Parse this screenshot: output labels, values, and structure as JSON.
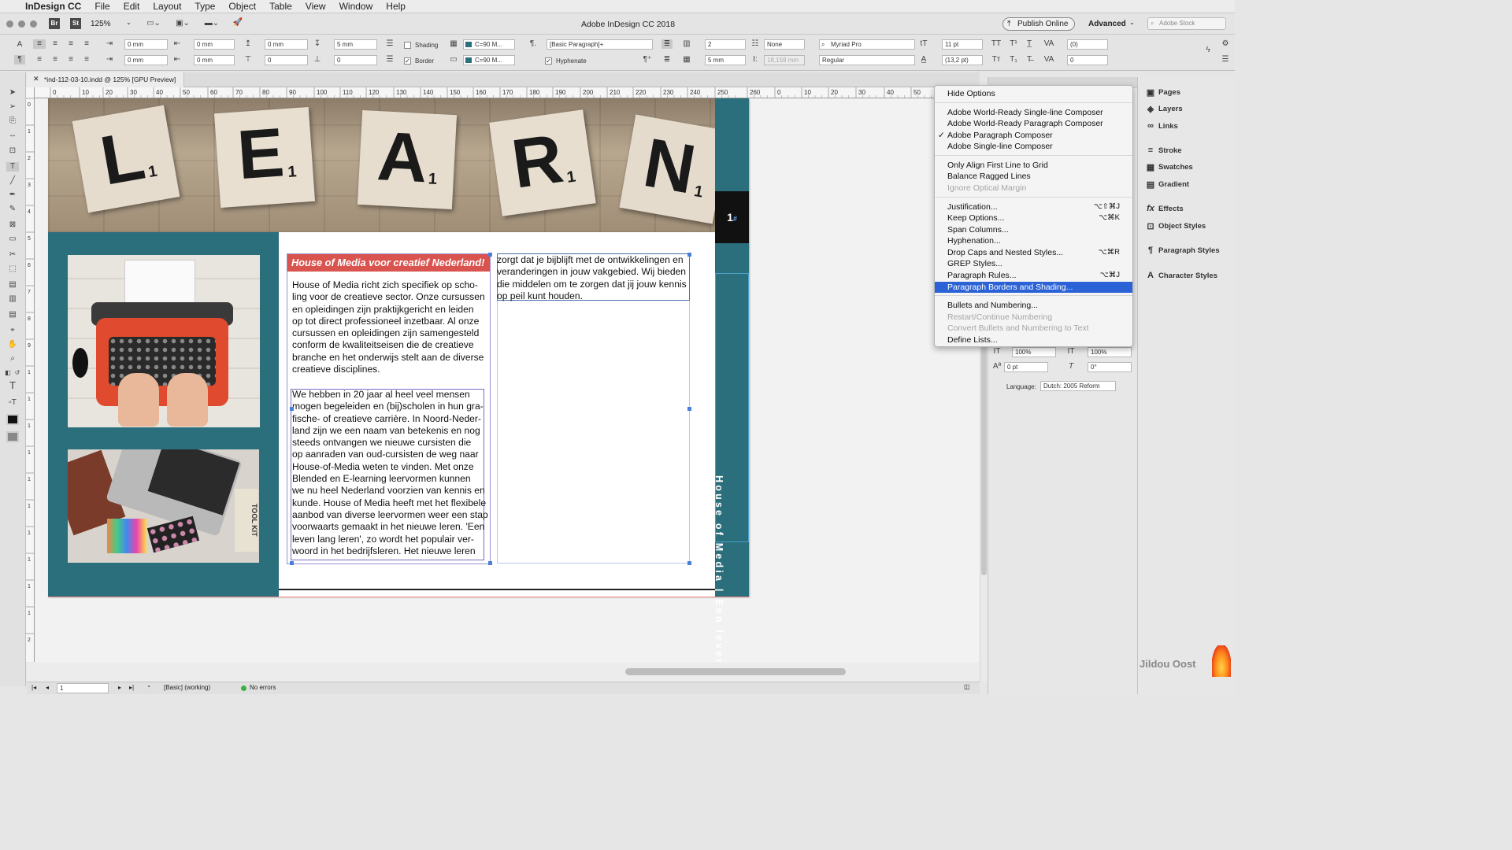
{
  "menubar": {
    "apple": "",
    "app": "InDesign CC",
    "items": [
      "File",
      "Edit",
      "Layout",
      "Type",
      "Object",
      "Table",
      "View",
      "Window",
      "Help"
    ]
  },
  "titlebar": {
    "bridge": "Br",
    "stock": "St",
    "zoom": "125%",
    "title": "Adobe InDesign CC 2018",
    "publish": "Publish Online",
    "workspace": "Advanced",
    "search_placeholder": "Adobe Stock"
  },
  "control": {
    "left_indent": "0 mm",
    "right_indent": "0 mm",
    "first_line": "0 mm",
    "last_line": "0 mm",
    "space_before": "0 mm",
    "space_after": "5 mm",
    "drop_lines": "0",
    "drop_chars": "0",
    "shading": "Shading",
    "border": "Border",
    "swatch1": "C=90 M...",
    "swatch2": "C=90 M...",
    "paragraph_style": "[Basic Paragraph]+",
    "hyphenate": "Hyphenate",
    "columns": "2",
    "gutter": "5 mm",
    "bullets": "None",
    "baseline": "18,159 mm",
    "font": "Myriad Pro",
    "font_style": "Regular",
    "size": "11 pt",
    "leading": "(13,2 pt)",
    "tracking": "(0)",
    "kerning": "0"
  },
  "document": {
    "tab_title": "*ind-112-03-10.indd @ 125% [GPU Preview]",
    "ruler_ticks": [
      "0",
      "10",
      "20",
      "30",
      "40",
      "50",
      "60",
      "70",
      "80",
      "90",
      "100",
      "110",
      "120",
      "130",
      "140",
      "150",
      "160",
      "170",
      "180",
      "190",
      "200",
      "210",
      "220",
      "230",
      "240",
      "250",
      "260",
      "0",
      "10",
      "20",
      "30",
      "40",
      "50",
      "60",
      "70"
    ],
    "vruler_ticks": [
      "0",
      "1",
      "2",
      "3",
      "4",
      "5",
      "6",
      "7",
      "8",
      "9",
      "1",
      "1",
      "1",
      "1",
      "1",
      "1",
      "1",
      "1",
      "1",
      "1",
      "2"
    ],
    "header_letters": [
      {
        "letter": "L",
        "sub": "1"
      },
      {
        "letter": "E",
        "sub": "1"
      },
      {
        "letter": "A",
        "sub": "1"
      },
      {
        "letter": "R",
        "sub": "1"
      },
      {
        "letter": "N",
        "sub": "1"
      }
    ],
    "page_number": "1",
    "page_number_marker": "#",
    "vertical_text": "House of Media | Een leven lang leren",
    "heading": "House of Media voor creatief Nederland!",
    "para1": [
      "House of Media richt zich specifiek op scho-",
      "ling voor de creatieve sector. Onze cursussen",
      "en opleidingen zijn praktijkgericht en leiden",
      "op tot direct professioneel inzetbaar. Al onze",
      "cursussen en opleidingen zijn samengesteld",
      "conform de kwaliteitseisen die de creatieve",
      "branche en het onderwijs stelt aan de diverse",
      "creatieve disciplines."
    ],
    "para2": [
      "We hebben in 20 jaar al heel veel mensen",
      "mogen begeleiden en (bij)scholen in hun gra-",
      "fische- of creatieve carrière. In Noord-Neder-",
      "land zijn we een naam van betekenis en nog",
      "steeds ontvangen we nieuwe cursisten die",
      "op aanraden van oud-cursisten de weg naar",
      "House-of-Media weten te vinden. Met onze",
      "Blended en E-learning leervormen kunnen",
      "we nu heel Nederland voorzien van kennis en",
      "kunde. House of Media heeft met het flexibele",
      "aanbod van diverse leervormen weer een stap",
      "voorwaarts gemaakt in het nieuwe leren. 'Een",
      "leven lang leren', zo wordt het populair ver-",
      "woord in het bedrijfsleren. Het nieuwe leren"
    ],
    "para3": [
      "zorgt dat je bijblijft met de ontwikkelingen en",
      "veranderingen in jouw vakgebied. Wij bieden",
      "die middelen om te zorgen dat jij jouw kennis",
      "op peil kunt houden."
    ],
    "toolkit_label": "TOOL KIT"
  },
  "dropdown": {
    "items": [
      {
        "label": "Hide Options",
        "shortcut": "",
        "disabled": false
      },
      {
        "label": "Adobe World-Ready Single-line Composer",
        "shortcut": "",
        "disabled": false
      },
      {
        "label": "Adobe World-Ready Paragraph Composer",
        "shortcut": "",
        "disabled": false
      },
      {
        "label": "Adobe Paragraph Composer",
        "shortcut": "",
        "disabled": false,
        "checked": true
      },
      {
        "label": "Adobe Single-line Composer",
        "shortcut": "",
        "disabled": false
      },
      {
        "label": "Only Align First Line to Grid",
        "shortcut": "",
        "disabled": false
      },
      {
        "label": "Balance Ragged Lines",
        "shortcut": "",
        "disabled": false
      },
      {
        "label": "Ignore Optical Margin",
        "shortcut": "",
        "disabled": true
      },
      {
        "label": "Justification...",
        "shortcut": "⌥⇧⌘J",
        "disabled": false
      },
      {
        "label": "Keep Options...",
        "shortcut": "⌥⌘K",
        "disabled": false
      },
      {
        "label": "Span Columns...",
        "shortcut": "",
        "disabled": false
      },
      {
        "label": "Hyphenation...",
        "shortcut": "",
        "disabled": false
      },
      {
        "label": "Drop Caps and Nested Styles...",
        "shortcut": "⌥⌘R",
        "disabled": false
      },
      {
        "label": "GREP Styles...",
        "shortcut": "",
        "disabled": false
      },
      {
        "label": "Paragraph Rules...",
        "shortcut": "⌥⌘J",
        "disabled": false
      },
      {
        "label": "Paragraph Borders and Shading...",
        "shortcut": "",
        "disabled": false,
        "selected": true
      },
      {
        "label": "Bullets and Numbering...",
        "shortcut": "",
        "disabled": false
      },
      {
        "label": "Restart/Continue Numbering",
        "shortcut": "",
        "disabled": true
      },
      {
        "label": "Convert Bullets and Numbering to Text",
        "shortcut": "",
        "disabled": true
      },
      {
        "label": "Define Lists...",
        "shortcut": "",
        "disabled": false
      }
    ]
  },
  "para_panel": {
    "hscale": "100%",
    "vscale": "100%",
    "baseline": "0 pt",
    "skew": "0°",
    "language_label": "Language:",
    "language": "Dutch: 2005 Reform"
  },
  "dock": {
    "items": [
      {
        "label": "Pages",
        "icon": "pages-icon"
      },
      {
        "label": "Layers",
        "icon": "layers-icon"
      },
      {
        "label": "Links",
        "icon": "links-icon"
      },
      {
        "label": "Stroke",
        "icon": "stroke-icon"
      },
      {
        "label": "Swatches",
        "icon": "swatches-icon"
      },
      {
        "label": "Gradient",
        "icon": "gradient-icon"
      },
      {
        "label": "Effects",
        "icon": "effects-icon"
      },
      {
        "label": "Object Styles",
        "icon": "object-styles-icon"
      },
      {
        "label": "Paragraph Styles",
        "icon": "paragraph-styles-icon"
      },
      {
        "label": "Character Styles",
        "icon": "character-styles-icon"
      }
    ]
  },
  "status": {
    "page": "1",
    "profile": "[Basic] (working)",
    "preflight": "No errors"
  },
  "watermark": "Jildou Oost",
  "colors": {
    "teal": "#2b6e7c",
    "heading_bg": "#d9534f",
    "select": "#2b63d6"
  }
}
